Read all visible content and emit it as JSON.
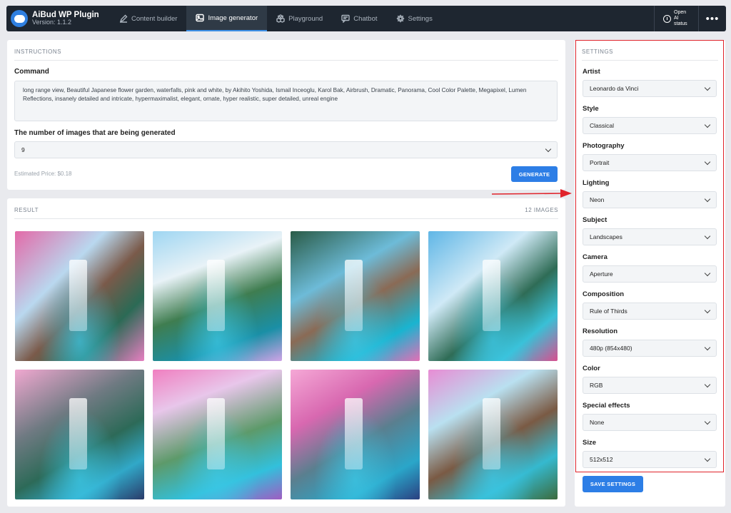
{
  "brand": {
    "title": "AiBud WP Plugin",
    "version": "Version: 1.1.2"
  },
  "nav": [
    {
      "label": "Content builder",
      "icon": "pen-icon"
    },
    {
      "label": "Image generator",
      "icon": "image-icon",
      "active": true
    },
    {
      "label": "Playground",
      "icon": "cubes-icon"
    },
    {
      "label": "Chatbot",
      "icon": "chat-icon"
    },
    {
      "label": "Settings",
      "icon": "gear-icon"
    }
  ],
  "ai_status": {
    "line1": "Open AI",
    "line2": "status"
  },
  "more_menu": "•••",
  "instructions": {
    "heading": "INSTRUCTIONS",
    "command_label": "Command",
    "command_text": "long range view, Beautiful Japanese flower garden, waterfalls, pink and white, by Akihito Yoshida, Ismail Inceoglu, Karol Bak, Airbrush, Dramatic, Panorama, Cool Color Palette, Megapixel, Lumen Reflections, insanely detailed and intricate, hypermaximalist, elegant, ornate, hyper realistic, super detailed, unreal engine",
    "count_label": "The number of images that are being generated",
    "count_value": "9",
    "estimated_price": "Estimated Price: $0.18",
    "generate_label": "GENERATE"
  },
  "result": {
    "heading": "RESULT",
    "count": "12 IMAGES"
  },
  "settings": {
    "heading": "SETTINGS",
    "fields": [
      {
        "label": "Artist",
        "value": "Leonardo da Vinci"
      },
      {
        "label": "Style",
        "value": "Classical"
      },
      {
        "label": "Photography",
        "value": "Portrait"
      },
      {
        "label": "Lighting",
        "value": "Neon"
      },
      {
        "label": "Subject",
        "value": "Landscapes"
      },
      {
        "label": "Camera",
        "value": "Aperture"
      },
      {
        "label": "Composition",
        "value": "Rule of Thirds"
      },
      {
        "label": "Resolution",
        "value": "480p (854x480)"
      },
      {
        "label": "Color",
        "value": "RGB"
      },
      {
        "label": "Special effects",
        "value": "None"
      },
      {
        "label": "Size",
        "value": "512x512"
      }
    ],
    "save_label": "SAVE SETTINGS"
  },
  "colors": {
    "accent": "#2d7ee6",
    "nav_bg": "#1e2630",
    "highlight": "#e0232b"
  }
}
